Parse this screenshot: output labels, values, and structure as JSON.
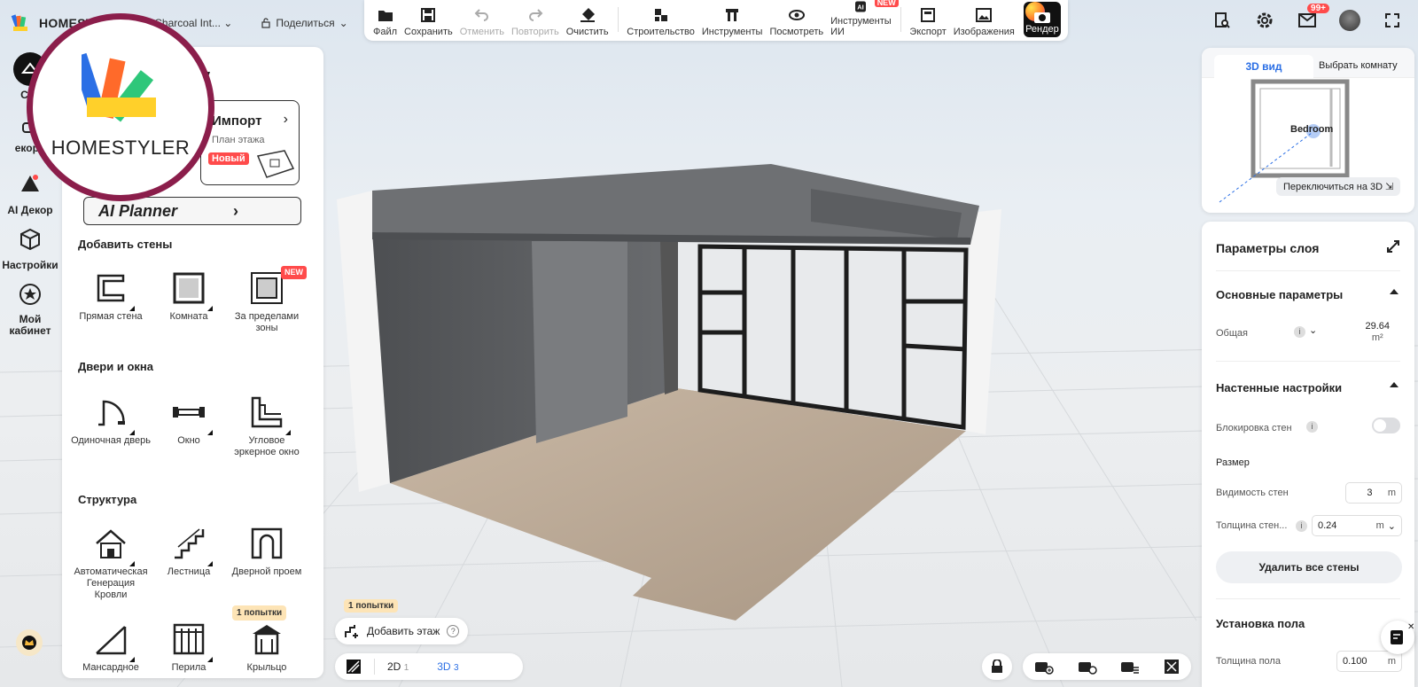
{
  "app": {
    "brand": "HOMESTYLER",
    "project_name": "Charcoal Int...",
    "share_label": "Поделиться"
  },
  "toolbar": {
    "items": [
      {
        "label": "Файл",
        "icon": "folder-icon",
        "enabled": true
      },
      {
        "label": "Сохранить",
        "icon": "save-icon",
        "enabled": true
      },
      {
        "label": "Отменить",
        "icon": "undo-icon",
        "enabled": false
      },
      {
        "label": "Повторить",
        "icon": "redo-icon",
        "enabled": false
      },
      {
        "label": "Очистить",
        "icon": "eraser-icon",
        "enabled": true
      },
      {
        "label": "Строительство",
        "icon": "build-icon",
        "enabled": true
      },
      {
        "label": "Инструменты",
        "icon": "tools-icon",
        "enabled": true
      },
      {
        "label": "Посмотреть",
        "icon": "eye-icon",
        "enabled": true
      },
      {
        "label": "Инструменты ИИ",
        "icon": "ai-icon",
        "enabled": true,
        "badge": "NEW"
      },
      {
        "label": "Экспорт",
        "icon": "export-icon",
        "enabled": true
      },
      {
        "label": "Изображения",
        "icon": "images-icon",
        "enabled": true
      }
    ],
    "render_label": "Рендер"
  },
  "topright": {
    "notifications_badge": "99+"
  },
  "rail": {
    "items": [
      {
        "label": "Стр",
        "icon": "build-rail-icon"
      },
      {
        "label": "екори",
        "icon": "decor-icon"
      },
      {
        "label": "AI Декор",
        "icon": "ai-decor-icon"
      },
      {
        "label": "Настройки",
        "icon": "settings-cube-icon"
      },
      {
        "label": "Мой кабинет",
        "icon": "cabinet-icon"
      }
    ]
  },
  "logo_overlay": {
    "text": "HOMESTYLER"
  },
  "leftpanel": {
    "heading_tail": "у",
    "import": {
      "title": "Импорт",
      "subtitle": "План этажа",
      "badge": "Новый"
    },
    "ai_planner": "AI Planner",
    "sections": [
      {
        "title": "Добавить стены",
        "tools": [
          {
            "label": "Прямая стена",
            "icon": "straight-wall-icon"
          },
          {
            "label": "Комната",
            "icon": "room-icon"
          },
          {
            "label": "За пределами зоны",
            "icon": "outside-zone-icon",
            "badge": "NEW"
          }
        ]
      },
      {
        "title": "Двери и окна",
        "tools": [
          {
            "label": "Одиночная дверь",
            "icon": "single-door-icon"
          },
          {
            "label": "Окно",
            "icon": "window-icon"
          },
          {
            "label": "Угловое эркерное окно",
            "icon": "corner-bay-window-icon"
          }
        ]
      },
      {
        "title": "Структура",
        "tools": [
          {
            "label": "Автоматическая Генерация Кровли",
            "icon": "auto-roof-icon"
          },
          {
            "label": "Лестница",
            "icon": "stairs-icon"
          },
          {
            "label": "Дверной проем",
            "icon": "door-opening-icon"
          },
          {
            "label": "Мансардное",
            "icon": "attic-icon"
          },
          {
            "label": "Перила",
            "icon": "railing-icon"
          },
          {
            "label": "Крыльцо",
            "icon": "porch-icon",
            "attempt": "1 попытки"
          }
        ]
      }
    ]
  },
  "minimap": {
    "tab_3d": "3D вид",
    "choose_room": "Выбрать комнату",
    "room_label": "Bedroom",
    "switch_3d": "Переключиться на 3D"
  },
  "props": {
    "title": "Параметры слоя",
    "basic": "Основные параметры",
    "total_label": "Общая",
    "total_value": "29.64",
    "total_unit": "m²",
    "wall_settings": "Настенные настройки",
    "lock_walls": "Блокировка стен",
    "lock_walls_on": false,
    "size": "Размер",
    "wall_height_label": "Видимость стен",
    "wall_height_value": "3",
    "wall_height_unit": "m",
    "wall_thickness_label": "Толщина стен...",
    "wall_thickness_value": "0.24",
    "wall_thickness_unit": "m",
    "delete_walls": "Удалить все стены",
    "floor_install": "Установка пола",
    "floor_thickness_label": "Толщина пола",
    "floor_thickness_value": "0.100",
    "floor_thickness_unit": "m"
  },
  "bottom": {
    "attempt_tag": "1 попытки",
    "add_floor": "Добавить этаж",
    "help": "?",
    "view2d": "2D",
    "view2d_num": "1",
    "view3d": "3D",
    "view3d_num": "3"
  },
  "colors": {
    "accent": "#2b6fe5",
    "badge_red": "#ff4b4b",
    "logo_ring": "#8b1e4b"
  }
}
